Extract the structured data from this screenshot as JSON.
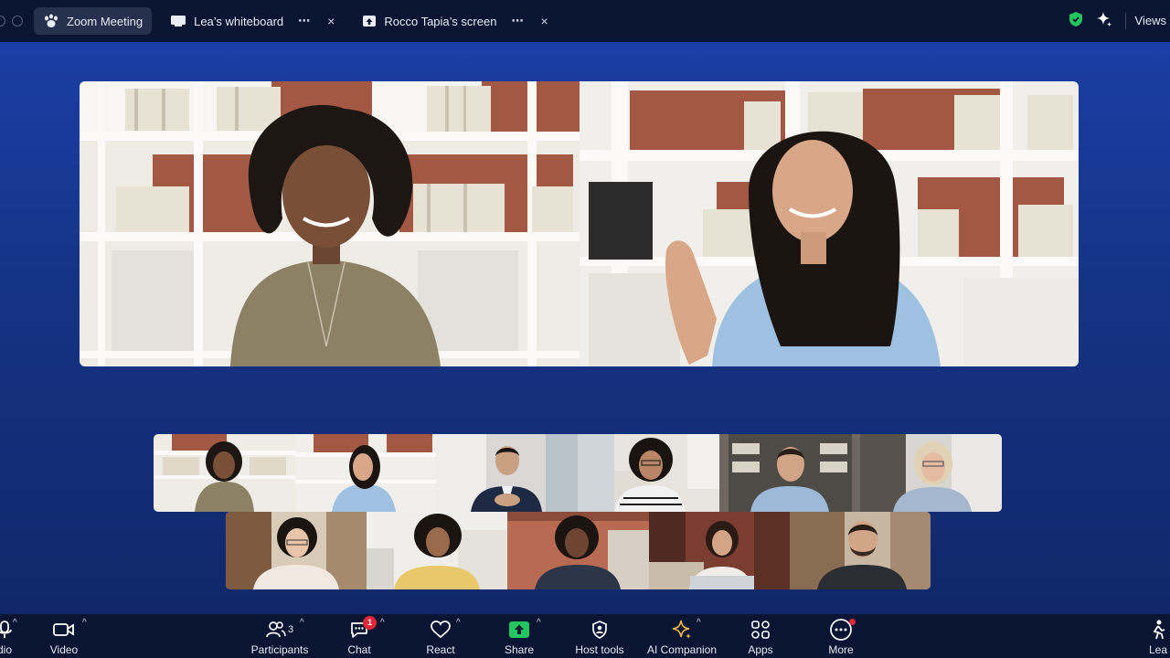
{
  "tabs": [
    {
      "label": "Zoom Meeting",
      "icon": "paw-icon",
      "active": true
    },
    {
      "label": "Lea’s whiteboard",
      "icon": "whiteboard-icon",
      "more": "⋯",
      "close": "×"
    },
    {
      "label": "Rocco Tapia’s screen",
      "icon": "share-screen-icon",
      "more": "⋯",
      "close": "×"
    }
  ],
  "topbar_right": {
    "views_label": "Views",
    "shield_color": "#22c55e"
  },
  "speakers": [
    {
      "name": "speaker-1",
      "shirt": "#8c8165"
    },
    {
      "name": "speaker-2",
      "shirt": "#9ec1e2"
    }
  ],
  "gallery": {
    "row1": 6,
    "row2": 5
  },
  "toolbar": {
    "audio": "dio",
    "video": "Video",
    "participants": "Participants",
    "participants_count": "3",
    "chat": "Chat",
    "chat_badge": "1",
    "react": "React",
    "share": "Share",
    "host_tools": "Host tools",
    "ai_companion": "AI Companion",
    "apps": "Apps",
    "more": "More",
    "leave": "Lea"
  },
  "colors": {
    "share_green": "#22c55e",
    "badge_red": "#e0283a",
    "stage_blue": "#1a3ea6"
  }
}
